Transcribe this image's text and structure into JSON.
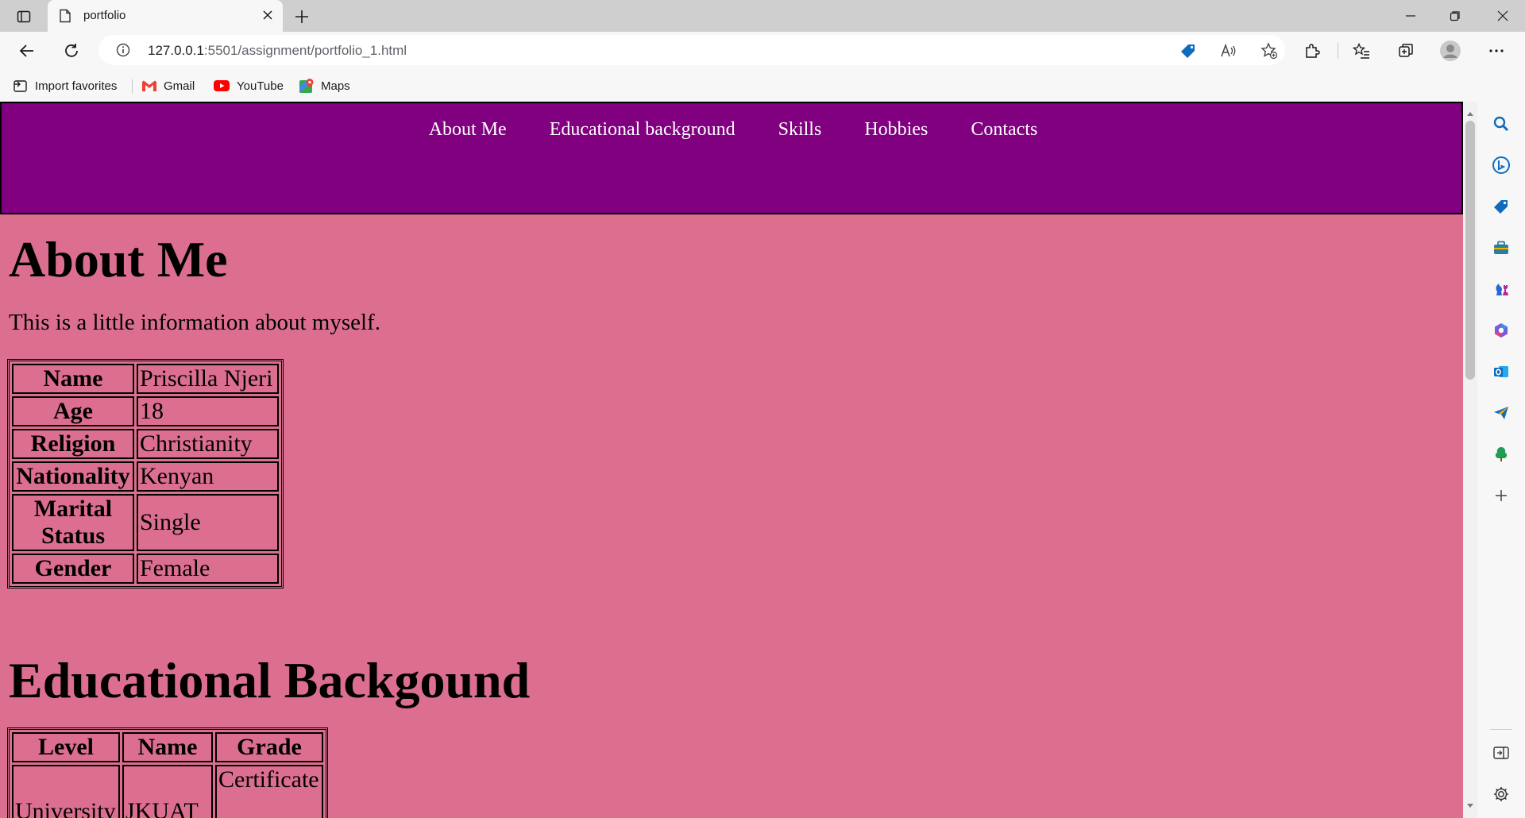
{
  "browser": {
    "tab": {
      "title": "portfolio"
    },
    "address": {
      "host": "127.0.0.1",
      "path": ":5501/assignment/portfolio_1.html"
    },
    "favorites": [
      {
        "label": "Import favorites",
        "icon": "import-icon"
      },
      {
        "label": "Gmail",
        "icon": "gmail-icon"
      },
      {
        "label": "YouTube",
        "icon": "youtube-icon"
      },
      {
        "label": "Maps",
        "icon": "maps-icon"
      }
    ],
    "colors": {
      "chrome": "#f7f7f7",
      "tabstrip": "#cfcfcf",
      "accent": "#0f6cbd"
    }
  },
  "page": {
    "nav": [
      "About Me",
      "Educational background",
      "Skills",
      "Hobbies",
      "Contacts"
    ],
    "colors": {
      "nav_bg": "#800080",
      "page_bg": "#dc6f8f"
    },
    "about": {
      "title": "About Me",
      "intro": "This is a little information about myself.",
      "rows": [
        {
          "label": "Name",
          "value": "Priscilla Njeri"
        },
        {
          "label": "Age",
          "value": "18"
        },
        {
          "label": "Religion",
          "value": "Christianity"
        },
        {
          "label": "Nationality",
          "value": "Kenyan"
        },
        {
          "label": "Marital Status",
          "value": "Single"
        },
        {
          "label": "Gender",
          "value": "Female"
        }
      ]
    },
    "education": {
      "title": "Educational Backgound",
      "headers": [
        "Level",
        "Name",
        "Grade"
      ],
      "rows": [
        {
          "level": "University",
          "name": "JKUAT",
          "grade": "Certificate"
        }
      ]
    }
  }
}
